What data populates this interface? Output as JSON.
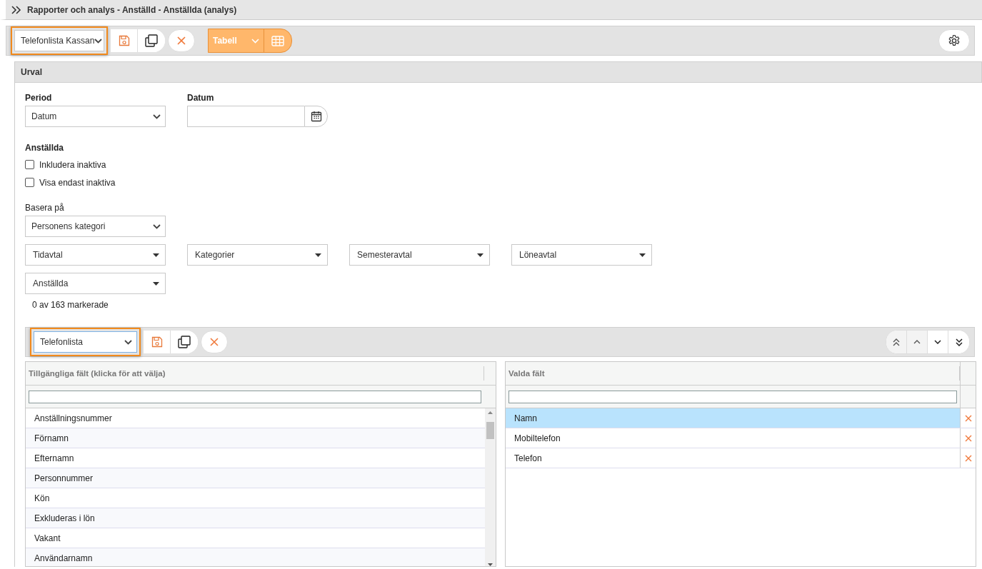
{
  "header": {
    "title": "Rapporter och analys - Anställd - Anställda (analys)"
  },
  "toolbar": {
    "report_select": {
      "value": "Telefonlista Kassan",
      "highlighted": true
    },
    "view_select": {
      "value": "Tabell"
    }
  },
  "selection": {
    "title": "Urval",
    "period": {
      "label": "Period",
      "value": "Datum"
    },
    "date": {
      "label": "Datum"
    },
    "employees": {
      "title": "Anställda",
      "checkboxes": [
        {
          "label": "Inkludera inaktiva",
          "checked": false
        },
        {
          "label": "Visa endast inaktiva",
          "checked": false
        }
      ]
    },
    "base_on": {
      "label": "Basera på",
      "value": "Personens kategori"
    },
    "filters": [
      {
        "label": "Tidavtal"
      },
      {
        "label": "Kategorier"
      },
      {
        "label": "Semesteravtal"
      },
      {
        "label": "Löneavtal"
      },
      {
        "label": "Anställda"
      }
    ],
    "count_text": "0 av 163 markerade"
  },
  "field_toolbar": {
    "layout_select": {
      "value": "Telefonlista",
      "highlighted": true
    }
  },
  "available": {
    "header": "Tillgängliga fält (klicka för att välja)",
    "items": [
      {
        "label": "Anställningsnummer"
      },
      {
        "label": "Förnamn"
      },
      {
        "label": "Efternamn"
      },
      {
        "label": "Personnummer"
      },
      {
        "label": "Kön"
      },
      {
        "label": "Exkluderas i lön"
      },
      {
        "label": "Vakant"
      },
      {
        "label": "Användarnamn"
      }
    ]
  },
  "chosen": {
    "header": "Valda fält",
    "items": [
      {
        "label": "Namn",
        "selected": true
      },
      {
        "label": "Mobiltelefon",
        "selected": false
      },
      {
        "label": "Telefon",
        "selected": false
      }
    ]
  }
}
